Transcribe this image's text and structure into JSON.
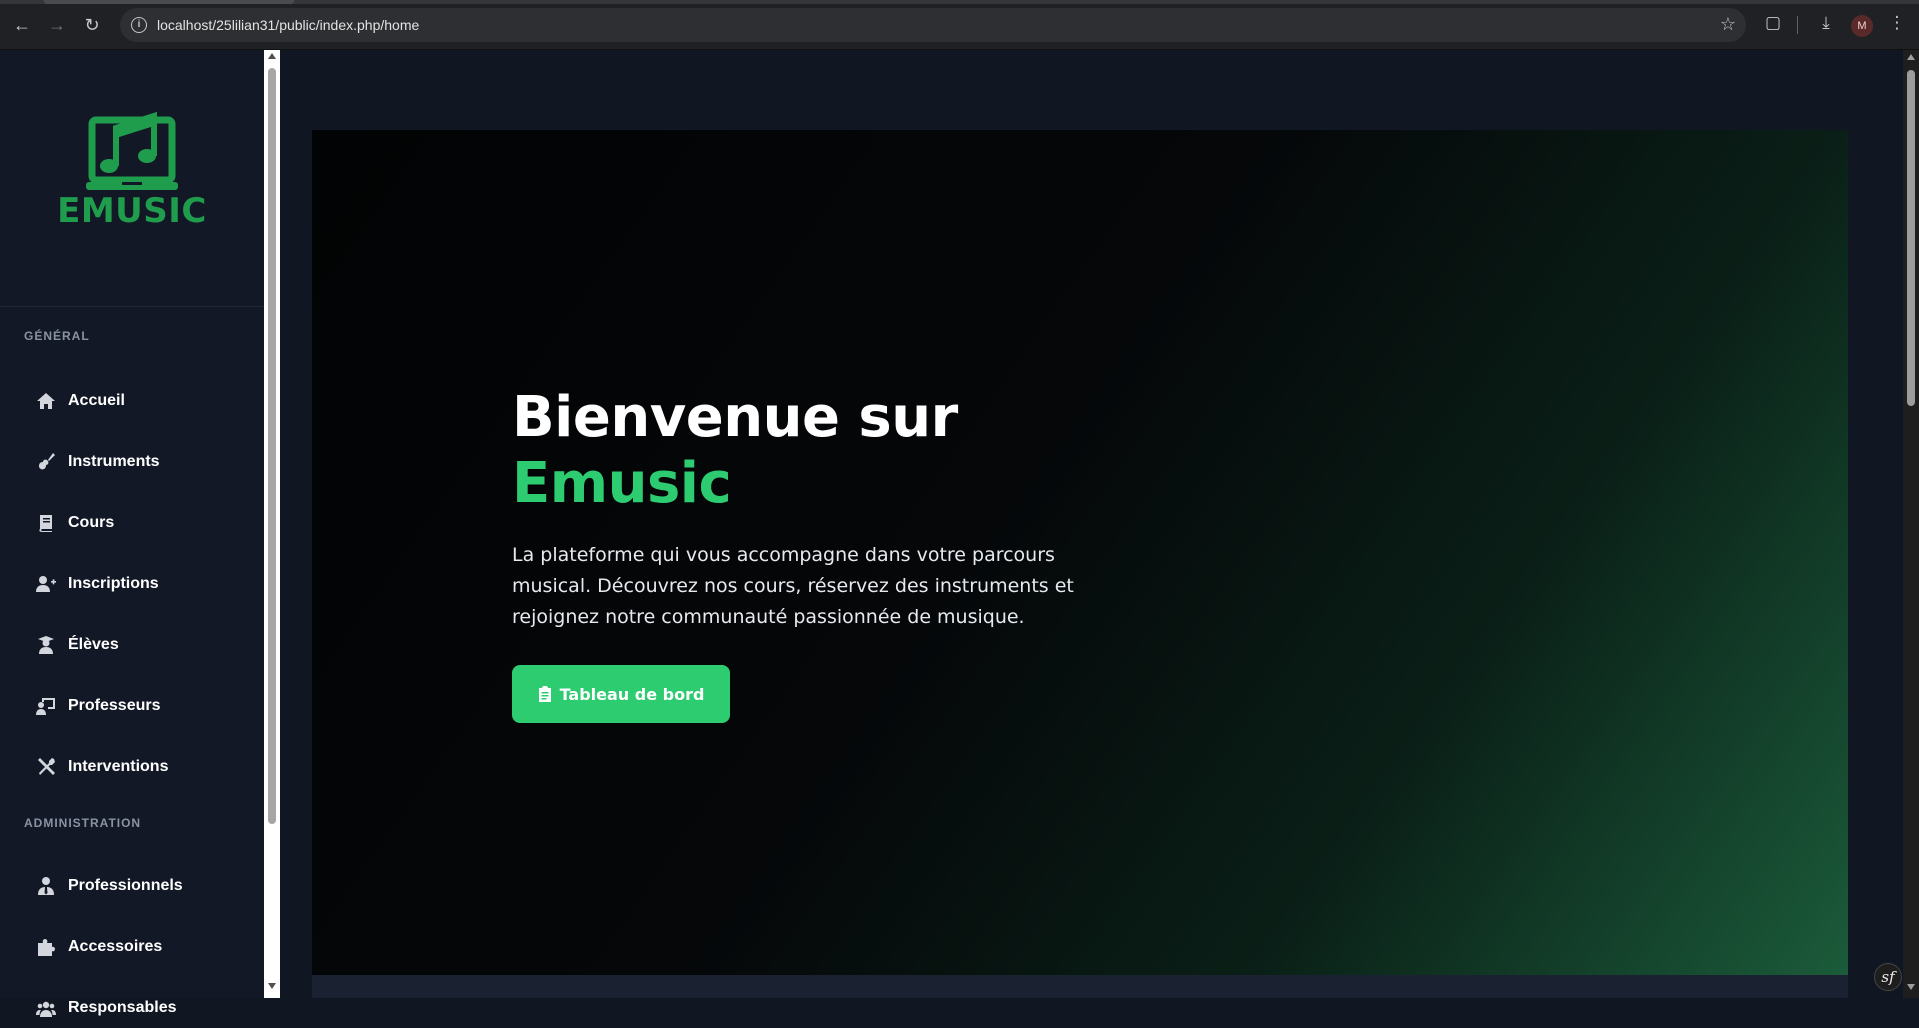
{
  "browser": {
    "url": "localhost/25lilian31/public/index.php/home",
    "profile_initial": "M"
  },
  "brand": {
    "name": "EMUSIC",
    "color": "#1f9d4c"
  },
  "sidebar": {
    "sections": [
      {
        "label": "GÉNÉRAL",
        "items": [
          {
            "label": "Accueil",
            "icon": "home-icon"
          },
          {
            "label": "Instruments",
            "icon": "guitar-icon"
          },
          {
            "label": "Cours",
            "icon": "book-icon"
          },
          {
            "label": "Inscriptions",
            "icon": "user-plus-icon"
          },
          {
            "label": "Élèves",
            "icon": "student-icon"
          },
          {
            "label": "Professeurs",
            "icon": "teacher-icon"
          },
          {
            "label": "Interventions",
            "icon": "tools-icon"
          }
        ]
      },
      {
        "label": "ADMINISTRATION",
        "items": [
          {
            "label": "Professionnels",
            "icon": "user-tie-icon"
          },
          {
            "label": "Accessoires",
            "icon": "puzzle-icon"
          },
          {
            "label": "Responsables",
            "icon": "users-icon"
          }
        ]
      }
    ]
  },
  "hero": {
    "title_line1": "Bienvenue sur",
    "title_line2": "Emusic",
    "description": "La plateforme qui vous accompagne dans votre parcours musical. Découvrez nos cours, réservez des instruments et rejoignez notre communauté passionnée de musique.",
    "button_label": "Tableau de bord",
    "accent_color": "#2ecc71"
  },
  "debug_toolbar": {
    "label": "sf"
  }
}
